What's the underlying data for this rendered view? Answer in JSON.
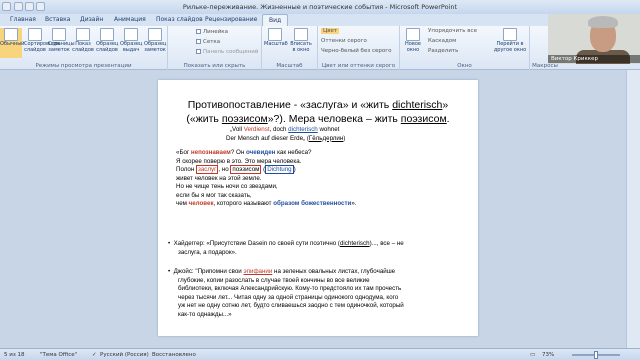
{
  "window": {
    "title": "Рильке-переживание. Жизненные и поэтические события - Microsoft PowerPoint"
  },
  "tabs": [
    "Главная",
    "Вставка",
    "Дизайн",
    "Анимация",
    "Показ слайдов",
    "Рецензирование",
    "Вид"
  ],
  "active_tab": "Вид",
  "ribbon": {
    "views": {
      "buttons": [
        "Обычный",
        "Сортировщик слайдов",
        "Страницы заметок",
        "Показ слайдов",
        "Образец слайдов",
        "Образец выдач",
        "Образец заметок"
      ],
      "label": "Режимы просмотра презентации"
    },
    "show": {
      "items": [
        "Линейка",
        "Сетка",
        "Панель сообщений"
      ],
      "label": "Показать или скрыть"
    },
    "zoom": {
      "buttons": [
        "Масштаб",
        "Вписать в окно"
      ],
      "label": "Масштаб"
    },
    "color": {
      "items": [
        "Цвет",
        "Оттенки серого",
        "Черно-белый без серого"
      ],
      "label": "Цвет или оттенки серого"
    },
    "window": {
      "buttons": [
        "Новое окно"
      ],
      "items": [
        "Упорядочить все",
        "Каскадом",
        "Разделить"
      ],
      "switch": "Перейти в другое окно",
      "label": "Окно"
    },
    "macros": {
      "label": "Макросы"
    }
  },
  "webcam": {
    "name": "Виктор Криккер"
  },
  "slide": {
    "title_line1_a": "Противопоставление - «заслуга» и «жить ",
    "title_line1_b": "dichterisch",
    "title_line1_c": "»",
    "title_line2_a": "(«жить ",
    "title_line2_b": "поэзисом",
    "title_line2_c": "»?). Мера человека – жить ",
    "title_line2_d": "поэзисом",
    "title_line2_e": ".",
    "german1_a": "„Voll ",
    "german1_b": "Verdienst",
    "german1_c": ", doch ",
    "german1_d": "dichterisch",
    "german1_e": " wohnet",
    "german2_a": "Der Mensch auf dieser Erde„ (",
    "german2_b": "Гёльдерлин",
    "german2_c": ")",
    "poem1_a": "«Бог ",
    "poem1_b": "непознаваем",
    "poem1_c": "? Он ",
    "poem1_d": "очевиден",
    "poem1_e": " как небеса?",
    "poem2": "Я скорее поверю в это. Это мера человека.",
    "poem3_a": "Полон ",
    "poem3_b": "заслуг",
    "poem3_c": ", но ",
    "poem3_d": "поэзисом",
    "poem3_e": " (",
    "poem3_f": "Dichtung",
    "poem3_g": ")",
    "poem4": "живет человек на этой земле.",
    "poem5": "Но не чище тень ночи со звездами,",
    "poem6": "если бы я мог так сказать,",
    "poem7_a": "чем ",
    "poem7_b": "человек",
    "poem7_c": ", которого называют ",
    "poem7_d": "образом божественности",
    "poem7_e": "».",
    "bullet1_a": "Хайдеггер: «Присутствие Dasein по своей сути поэтично (",
    "bullet1_b": "dichterisch",
    "bullet1_c": ")..., все – не",
    "bullet1_d": "заслуга, а подарок».",
    "bullet2_a": "Джойс: \"Припомни свои ",
    "bullet2_b": "эпифании",
    "bullet2_c": " на зеленых овальных листах, глубочайше",
    "bullet2_d": "глубокие, копии разослать в случае твоей кончины во все великие",
    "bullet2_e": "библиотеки, включая Александрийскую. Кому-то предстояло их там прочесть",
    "bullet2_f": "через тысячи лет... Читая одну за одной страницы одинокого однодума, кого",
    "bullet2_g": "уж нет не одну сотню лет, будто сливаешься заодно с тем одиночкой, который",
    "bullet2_h": "как-то однажды...»"
  },
  "status": {
    "slide": "5 из 18",
    "theme": "\"Тема Office\"",
    "lang": "Русский (Россия)",
    "state": "Восстановлено",
    "zoom": "73%"
  }
}
